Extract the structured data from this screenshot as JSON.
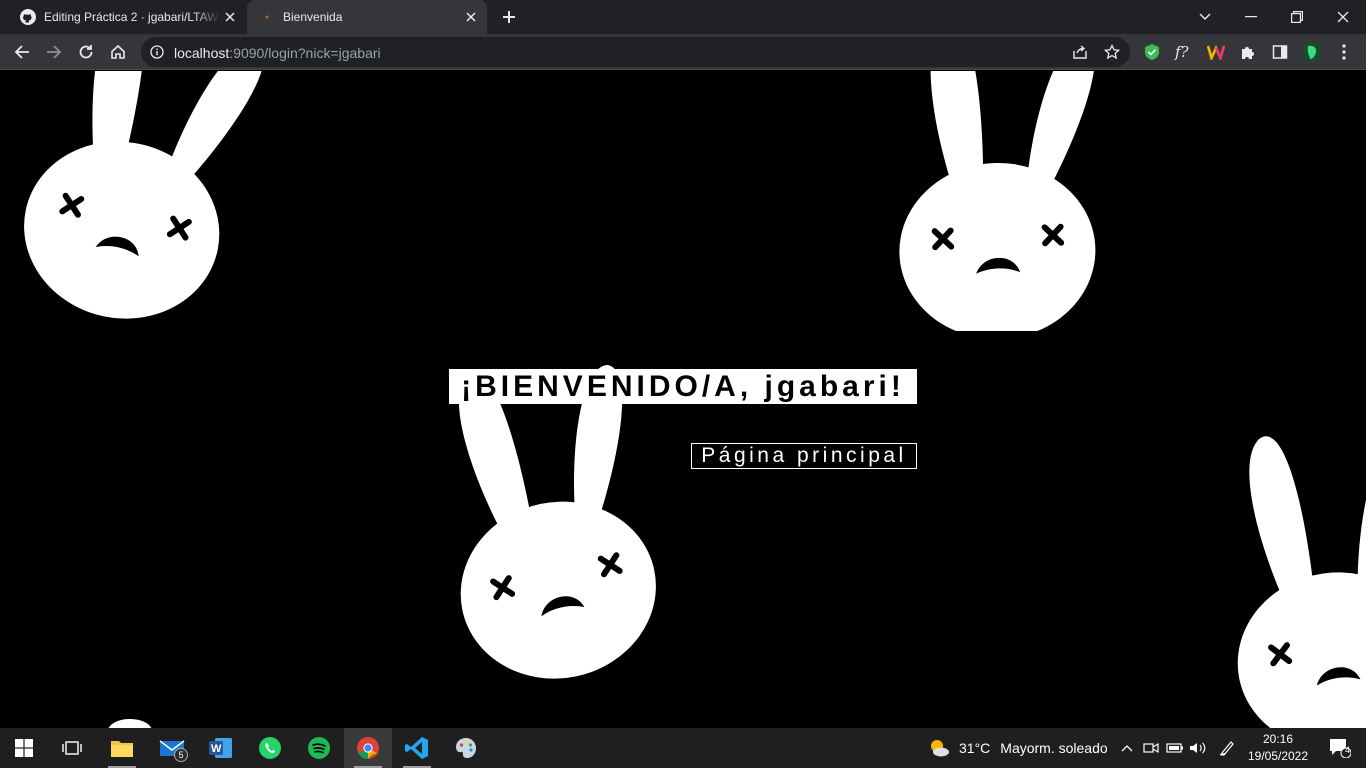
{
  "browser": {
    "tabs": [
      {
        "title": "Editing Práctica 2 · jgabari/LTAW-",
        "active": false,
        "favicon": "github-icon"
      },
      {
        "title": "Bienvenida",
        "active": true,
        "favicon": "site-favicon-icon"
      }
    ],
    "url": {
      "host": "localhost",
      "rest": ":9090/login?nick=jgabari"
    }
  },
  "page": {
    "greeting": "¡BIENVENIDO/A, jgabari!",
    "main_link": "Página principal"
  },
  "taskbar": {
    "mail_badge": "5",
    "weather": {
      "temp": "31°C",
      "desc": "Mayorm. soleado"
    },
    "clock": {
      "time": "20:16",
      "date": "19/05/2022"
    },
    "notification_count": "4"
  },
  "colors": {
    "accent_green": "#1db954",
    "whatsapp": "#25d366",
    "vscode": "#22a6f2",
    "word": "#2b579a"
  }
}
